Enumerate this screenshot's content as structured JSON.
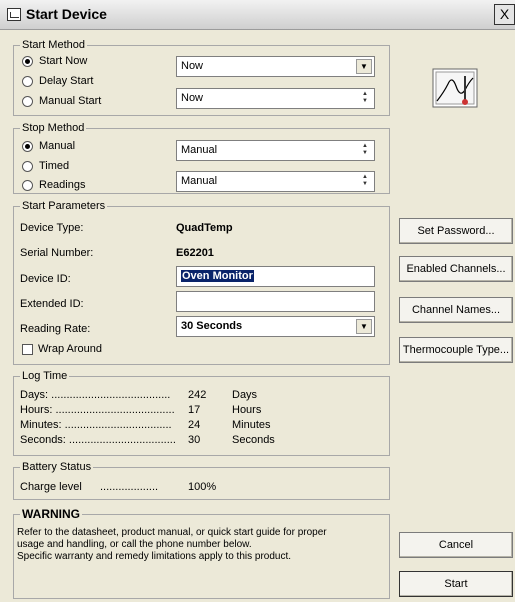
{
  "window": {
    "title": "Start Device",
    "close_glyph": "X"
  },
  "start_method": {
    "legend": "Start Method",
    "options": [
      "Start Now",
      "Delay Start",
      "Manual Start"
    ],
    "selected_index": 0,
    "top_select_value": "Now",
    "bottom_spinner_value": "Now"
  },
  "stop_method": {
    "legend": "Stop Method",
    "options": [
      "Manual",
      "Timed",
      "Readings"
    ],
    "selected_index": 0,
    "top_spinner_value": "Manual",
    "bottom_spinner_value": "Manual"
  },
  "start_parameters": {
    "legend": "Start Parameters",
    "device_type_label": "Device Type:",
    "device_type_value": "QuadTemp",
    "serial_label": "Serial Number:",
    "serial_value": "E62201",
    "device_id_label": "Device ID:",
    "device_id_value": "Oven Monitor",
    "extended_id_label": "Extended ID:",
    "extended_id_value": "",
    "reading_rate_label": "Reading Rate:",
    "reading_rate_value": "30 Seconds",
    "wrap_around_label": "Wrap Around"
  },
  "log_time": {
    "legend": "Log Time",
    "rows": [
      {
        "label": "Days: .......................................",
        "value": "242",
        "unit": "Days"
      },
      {
        "label": "Hours: .......................................",
        "value": "17",
        "unit": "Hours"
      },
      {
        "label": "Minutes: ...................................",
        "value": "24",
        "unit": "Minutes"
      },
      {
        "label": "Seconds: ...................................",
        "value": "30",
        "unit": "Seconds"
      }
    ]
  },
  "battery": {
    "legend": "Battery Status",
    "label": "Charge level",
    "dots": "...................",
    "value": "100%"
  },
  "warning": {
    "legend": "WARNING",
    "lines": [
      "Refer to the datasheet, product manual, or quick start guide for proper",
      "usage and handling, or call the phone number below.",
      "Specific warranty and remedy limitations apply to this product."
    ]
  },
  "buttons": {
    "set_password": "Set Password...",
    "enabled_channels": "Enabled Channels...",
    "channel_names": "Channel Names...",
    "thermocouple_type": "Thermocouple Type...",
    "cancel": "Cancel",
    "start": "Start"
  },
  "icons": [
    "app-icon",
    "graph-icon",
    "dropdown-arrow-icon",
    "spin-arrow-icon"
  ]
}
